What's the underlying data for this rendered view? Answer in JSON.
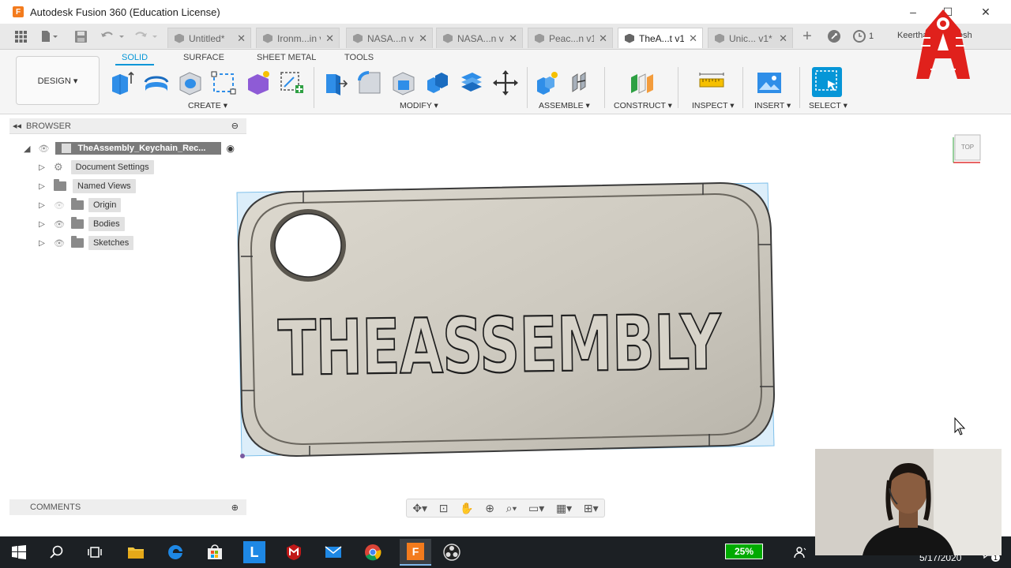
{
  "window": {
    "title": "Autodesk Fusion 360 (Education License)",
    "app_icon_letter": "F",
    "minimize": "–",
    "maximize": "☐",
    "close": "✕"
  },
  "tabs": [
    {
      "label": "Untitled*",
      "active": false
    },
    {
      "label": "Ironm...in v1",
      "active": false
    },
    {
      "label": "NASA...n v1",
      "active": false
    },
    {
      "label": "NASA...n v1",
      "active": false
    },
    {
      "label": "Peac...n v1",
      "active": false
    },
    {
      "label": "TheA...t v1",
      "active": true
    },
    {
      "label": "Unic... v1*",
      "active": false
    }
  ],
  "tab_close": "✕",
  "add_tab": "+",
  "job_count": "1",
  "user_name": "Keerthana Ramesh",
  "workspace": {
    "label": "DESIGN ▾"
  },
  "subtabs": {
    "solid": "SOLID",
    "surface": "SURFACE",
    "sheet_metal": "SHEET METAL",
    "tools": "TOOLS"
  },
  "groups": {
    "create": "CREATE ▾",
    "modify": "MODIFY ▾",
    "assemble": "ASSEMBLE ▾",
    "construct": "CONSTRUCT ▾",
    "inspect": "INSPECT ▾",
    "insert": "INSERT ▾",
    "select": "SELECT ▾"
  },
  "browser": {
    "title": "BROWSER",
    "root": "TheAssembly_Keychain_Rec...",
    "items": [
      {
        "label": "Document Settings"
      },
      {
        "label": "Named Views"
      },
      {
        "label": "Origin"
      },
      {
        "label": "Bodies"
      },
      {
        "label": "Sketches"
      }
    ]
  },
  "comments": {
    "title": "COMMENTS"
  },
  "model": {
    "text": "THEASSEMBLY"
  },
  "viewcube": {
    "label": "TOP"
  },
  "taskbar": {
    "battery": "25%",
    "date": "5/17/2020",
    "notify_count": "1"
  },
  "colors": {
    "accent": "#0696d7",
    "body": "#cbc7bd",
    "taskbar": "#1c2024"
  }
}
